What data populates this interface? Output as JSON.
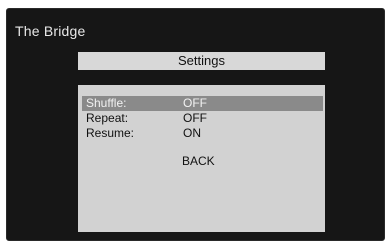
{
  "app": {
    "title": "The Bridge"
  },
  "menu": {
    "title": "Settings",
    "items": [
      {
        "label": "Shuffle:",
        "value": "OFF",
        "selected": true
      },
      {
        "label": "Repeat:",
        "value": "OFF",
        "selected": false
      },
      {
        "label": "Resume:",
        "value": "ON",
        "selected": false
      }
    ],
    "back_label": "BACK"
  },
  "colors": {
    "screen_bg": "#161616",
    "panel_bg": "#d2d2d2",
    "title_bar_bg": "#d8d8d8",
    "selected_bg": "#8a8a8a"
  }
}
